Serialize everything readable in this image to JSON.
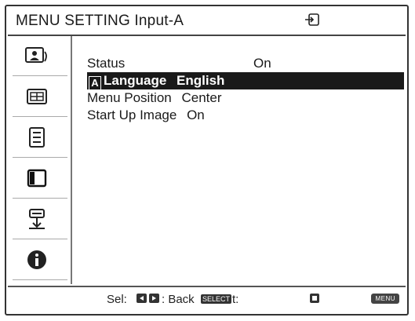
{
  "window": {
    "title": "MENU SETTING Input-A",
    "input_icon": "input-switch-icon"
  },
  "sidebar": {
    "items": [
      {
        "icon": "picture-icon"
      },
      {
        "icon": "screen-icon"
      },
      {
        "icon": "function-icon"
      },
      {
        "icon": "menu-setting-icon"
      },
      {
        "icon": "installation-icon"
      },
      {
        "icon": "information-icon"
      }
    ]
  },
  "menu": {
    "rows": [
      {
        "label": "Status",
        "value": "On",
        "selected": false
      },
      {
        "label": "Language",
        "value": "English",
        "selected": true
      },
      {
        "label": "Menu Position",
        "value": "Center",
        "selected": false
      },
      {
        "label": "Start Up Image",
        "value": "On",
        "selected": false
      }
    ]
  },
  "footer": {
    "sel": "Sel:",
    "back": ": Back",
    "set_key": "SELECT",
    "set_suffix": "t:",
    "menu_key": "MENU"
  },
  "colors": {
    "highlight": "#1a1a1a",
    "text": "#1a1a1a",
    "border": "#333333"
  }
}
